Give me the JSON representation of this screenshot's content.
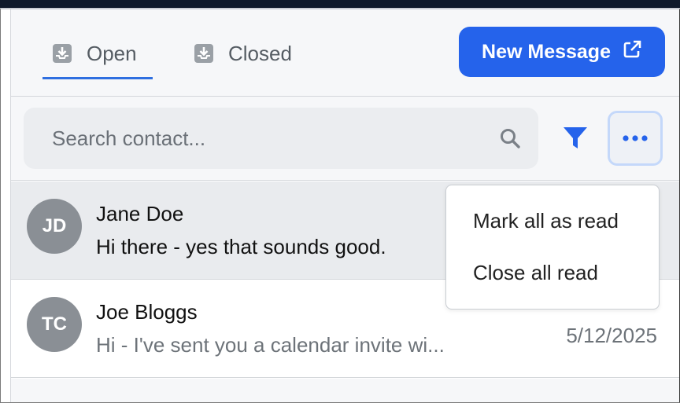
{
  "tabs": [
    {
      "label": "Open",
      "icon": "inbox-download-icon",
      "active": true
    },
    {
      "label": "Closed",
      "icon": "inbox-download-icon",
      "active": false
    }
  ],
  "actions": {
    "new_message_label": "New Message",
    "new_message_icon": "external-link-icon"
  },
  "search": {
    "placeholder": "Search contact...",
    "value": ""
  },
  "toolbar": {
    "filter_icon": "filter-icon",
    "more_icon": "more-horizontal-icon"
  },
  "conversations": [
    {
      "initials": "JD",
      "name": "Jane Doe",
      "preview": "Hi there - yes that sounds good.",
      "date": "",
      "selected": true
    },
    {
      "initials": "TC",
      "name": "Joe Bloggs",
      "preview": "Hi - I've sent you a calendar invite wi...",
      "date": "5/12/2025",
      "selected": false
    }
  ],
  "menu": {
    "items": [
      "Mark all as read",
      "Close all read"
    ]
  },
  "colors": {
    "accent": "#2563eb",
    "avatar": "#8a8f95",
    "selected_row": "#e9ebee"
  }
}
